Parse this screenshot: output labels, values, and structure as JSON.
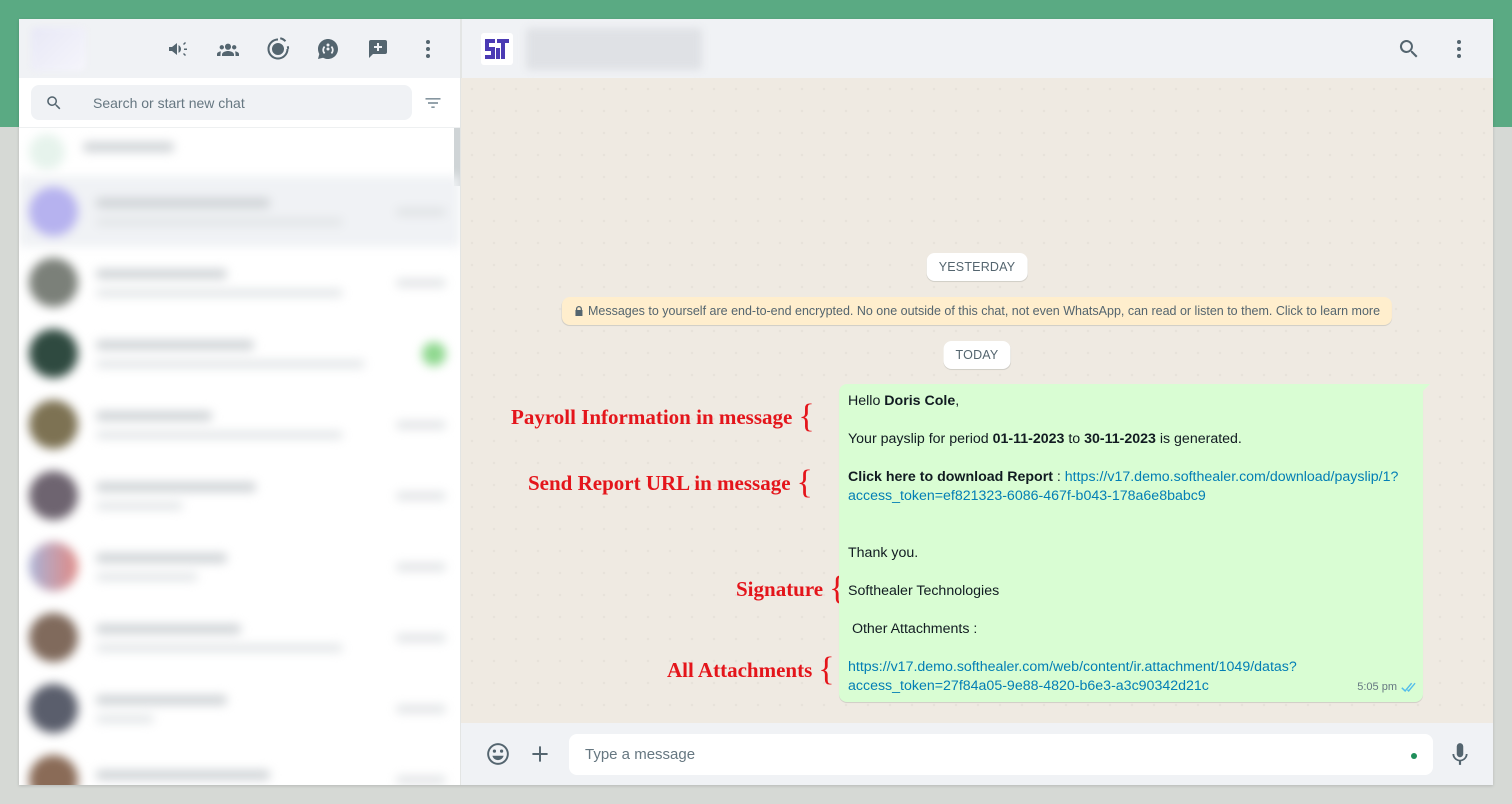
{
  "sidebar": {
    "search_placeholder": "Search or start new chat",
    "header_icons": [
      "megaphone-icon",
      "communities-icon",
      "status-icon",
      "channels-icon",
      "new-chat-icon",
      "menu-icon"
    ]
  },
  "chat": {
    "date_yesterday": "YESTERDAY",
    "encryption_note": "Messages to yourself are end-to-end encrypted. No one outside of this chat, not even WhatsApp, can read or listen to them. Click to learn more",
    "date_today": "TODAY",
    "message": {
      "greeting_prefix": "Hello ",
      "employee_name": "Doris Cole",
      "greeting_suffix": ",",
      "period_prefix": "Your payslip for period ",
      "period_start": "01-11-2023",
      "period_mid": " to ",
      "period_end": "30-11-2023",
      "period_suffix": " is generated.",
      "download_label": "Click here to download Report",
      "download_separator": " : ",
      "download_url_line1": "https://v17.demo.softhealer.com/download/payslip/1?",
      "download_url_line2": "access_token=ef821323-6086-467f-b043-178a6e8babc9",
      "thanks": "Thank you.",
      "signature": "Softhealer Technologies",
      "attachments_label": " Other Attachments :",
      "attachment_url_line1": "https://v17.demo.softhealer.com/web/content/ir.attachment/1049/datas?",
      "attachment_url_line2": "access_token=27f84a05-9e88-4820-b6e3-a3c90342d21c",
      "time": "5:05 pm"
    }
  },
  "annotations": {
    "payroll": "Payroll Information in message",
    "report_url": "Send Report URL in message",
    "signature": "Signature",
    "attachments": "All Attachments",
    "brace": "{"
  },
  "compose": {
    "placeholder": "Type a message"
  },
  "colors": {
    "brand_band": "#5aaa83",
    "bubble": "#d9fdd3",
    "annotation": "#e4151b",
    "link": "#027eb5"
  }
}
